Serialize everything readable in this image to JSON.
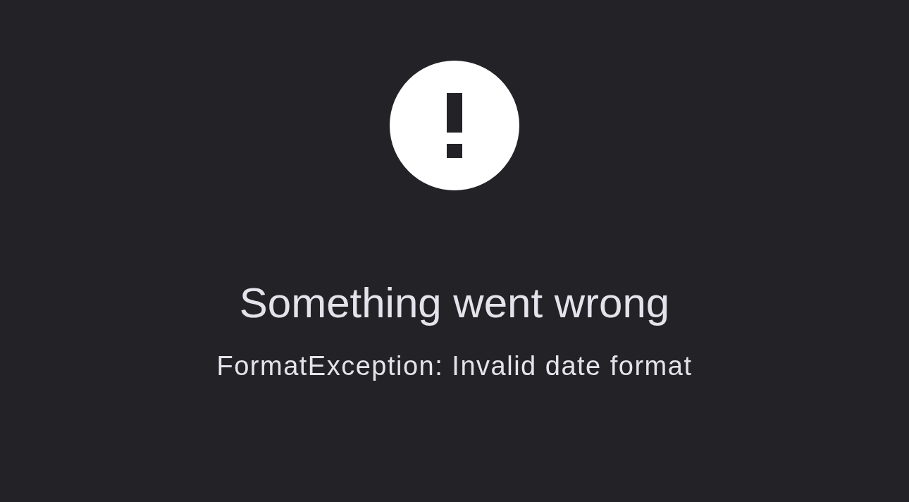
{
  "error": {
    "title": "Something went wrong",
    "message": "FormatException: Invalid date format"
  }
}
